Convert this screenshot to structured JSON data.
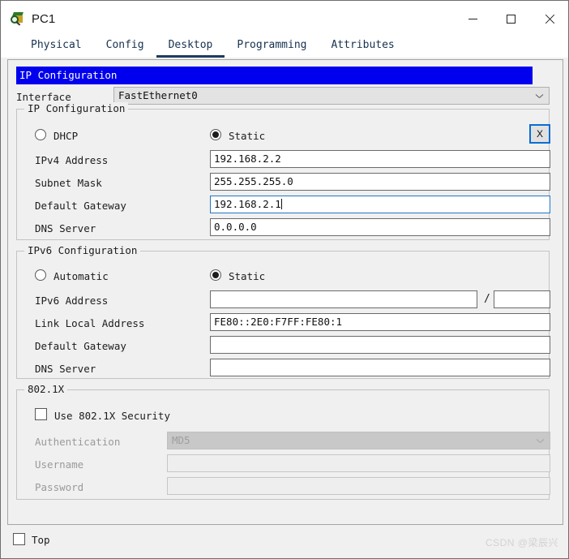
{
  "window": {
    "title": "PC1",
    "icon": "device-pc-icon",
    "controls": {
      "minimize": "minimize-icon",
      "maximize": "maximize-icon",
      "close": "close-icon"
    }
  },
  "tabs": [
    {
      "label": "Physical",
      "active": false
    },
    {
      "label": "Config",
      "active": false
    },
    {
      "label": "Desktop",
      "active": true
    },
    {
      "label": "Programming",
      "active": false
    },
    {
      "label": "Attributes",
      "active": false
    }
  ],
  "ip_configuration_window": {
    "title": "IP Configuration",
    "close_label": "X",
    "interface": {
      "label": "Interface",
      "value": "FastEthernet0"
    },
    "ipv4": {
      "group_title": "IP Configuration",
      "mode_dhcp_label": "DHCP",
      "mode_static_label": "Static",
      "selected_mode": "Static",
      "fields": [
        {
          "label": "IPv4 Address",
          "value": "192.168.2.2",
          "focused": false
        },
        {
          "label": "Subnet Mask",
          "value": "255.255.255.0",
          "focused": false
        },
        {
          "label": "Default Gateway",
          "value": "192.168.2.1",
          "focused": true
        },
        {
          "label": "DNS Server",
          "value": "0.0.0.0",
          "focused": false
        }
      ]
    },
    "ipv6": {
      "group_title": "IPv6 Configuration",
      "mode_automatic_label": "Automatic",
      "mode_static_label": "Static",
      "selected_mode": "Static",
      "address_label": "IPv6 Address",
      "address_value": "",
      "prefix_separator": "/",
      "prefix_value": "",
      "fields": [
        {
          "label": "Link Local Address",
          "value": "FE80::2E0:F7FF:FE80:1"
        },
        {
          "label": "Default Gateway",
          "value": ""
        },
        {
          "label": "DNS Server",
          "value": ""
        }
      ]
    },
    "dot1x": {
      "group_title": "802.1X",
      "use_security_label": "Use 802.1X Security",
      "use_security_checked": false,
      "authentication_label": "Authentication",
      "authentication_value": "MD5",
      "username_label": "Username",
      "username_value": "",
      "password_label": "Password",
      "password_value": ""
    }
  },
  "footer": {
    "top_label": "Top",
    "top_checked": false,
    "watermark": "CSDN @梁辰兴"
  },
  "colors": {
    "title_bar_blue": "#0000ee",
    "focus_blue": "#2176c7",
    "tab_underline": "#1f3a5f",
    "window_bg": "#f0f0f0"
  }
}
